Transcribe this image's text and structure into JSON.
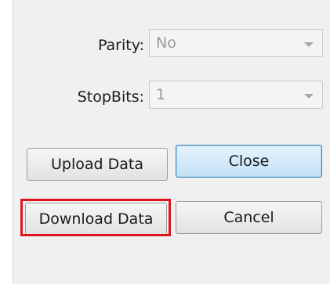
{
  "form": {
    "parity_label": "Parity:",
    "parity_value": "No",
    "stopbits_label": "StopBits:",
    "stopbits_value": "1"
  },
  "buttons": {
    "upload": "Upload Data",
    "close": "Close",
    "download": "Download Data",
    "cancel": "Cancel"
  },
  "icons": {
    "parity_arrow": "chevron-down-icon",
    "stopbits_arrow": "chevron-down-icon"
  },
  "colors": {
    "highlight": "#e0141c",
    "default_button": "#c3e1f6"
  }
}
